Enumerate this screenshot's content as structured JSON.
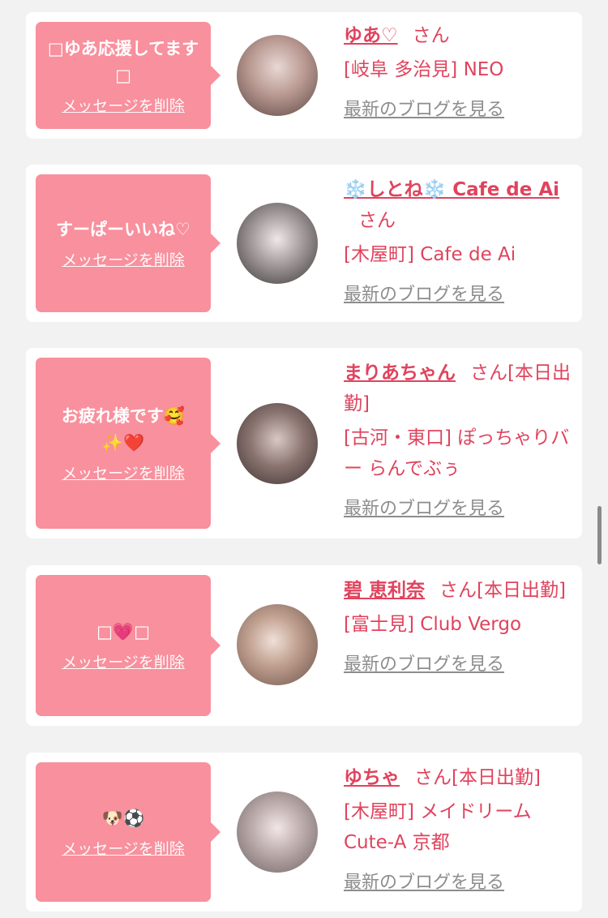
{
  "colors": {
    "bubble": "#f8909d",
    "accent": "#e0435d",
    "muted": "#8d8d8d",
    "background": "#f2f2f2"
  },
  "cards": [
    {
      "message": "□ゆあ応援してます□",
      "delete_label": "メッセージを削除",
      "name": "ゆあ♡",
      "honorific": "さん",
      "status": "",
      "shop": "[岐阜 多治見] NEO",
      "blog_label": "最新のブログを見る",
      "avatar_icon": "profile-photo"
    },
    {
      "message": "すーぱーいいね♡",
      "delete_label": "メッセージを削除",
      "name": "❄️しとね❄️ Cafe de Ai",
      "honorific": "さん",
      "status": "",
      "shop": "[木屋町] Cafe de Ai",
      "blog_label": "最新のブログを見る",
      "avatar_icon": "profile-photo"
    },
    {
      "message": "お疲れ様です🥰✨❤️",
      "delete_label": "メッセージを削除",
      "name": "まりあちゃん",
      "honorific": "さん",
      "status": "[本日出勤]",
      "shop": "[古河・東口] ぽっちゃりバー らんでぶぅ",
      "blog_label": "最新のブログを見る",
      "avatar_icon": "profile-photo"
    },
    {
      "message": "□💗□",
      "delete_label": "メッセージを削除",
      "name": "碧 恵利奈",
      "honorific": "さん",
      "status": "[本日出勤]",
      "shop": "[富士見] Club Vergo",
      "blog_label": "最新のブログを見る",
      "avatar_icon": "profile-photo"
    },
    {
      "message": "🐶⚽️",
      "delete_label": "メッセージを削除",
      "name": "ゆちゃ",
      "honorific": "さん",
      "status": "[本日出勤]",
      "shop": "[木屋町] メイドリーム Cute-A 京都",
      "blog_label": "最新のブログを見る",
      "avatar_icon": "profile-photo"
    }
  ]
}
